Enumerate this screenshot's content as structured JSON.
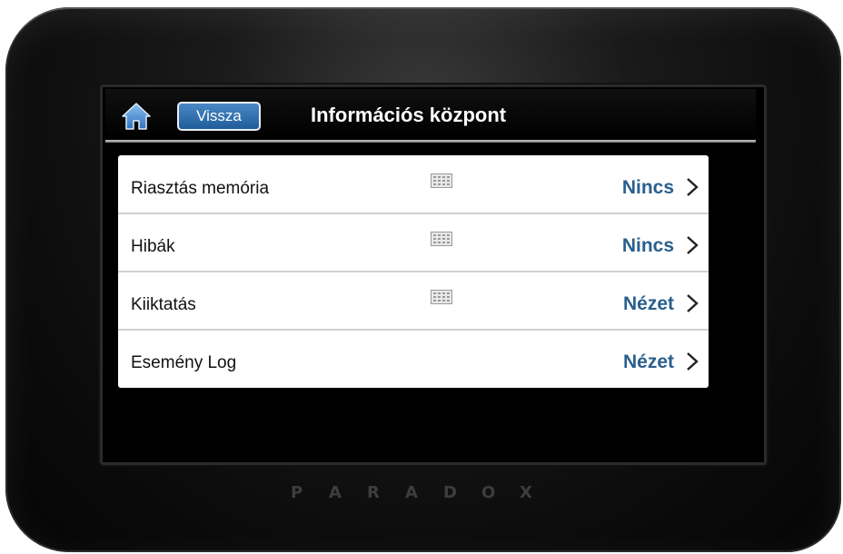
{
  "header": {
    "back_label": "Vissza",
    "title": "Információs központ",
    "home_icon": "home-icon"
  },
  "list": {
    "rows": [
      {
        "label": "Riasztás memória",
        "value": "Nincs",
        "has_keypad_icon": true
      },
      {
        "label": "Hibák",
        "value": "Nincs",
        "has_keypad_icon": true
      },
      {
        "label": "Kiiktatás",
        "value": "Nézet",
        "has_keypad_icon": true
      },
      {
        "label": "Esemény Log",
        "value": "Nézet",
        "has_keypad_icon": false
      }
    ]
  },
  "brand": {
    "letters": [
      "P",
      "A",
      "R",
      "A",
      "D",
      "O",
      "X"
    ]
  },
  "colors": {
    "accent_value": "#2a5f8d",
    "back_button": "#2f71b0",
    "home_icon": "#4a90d9",
    "screen_bg": "#000000",
    "list_bg": "#ffffff"
  }
}
